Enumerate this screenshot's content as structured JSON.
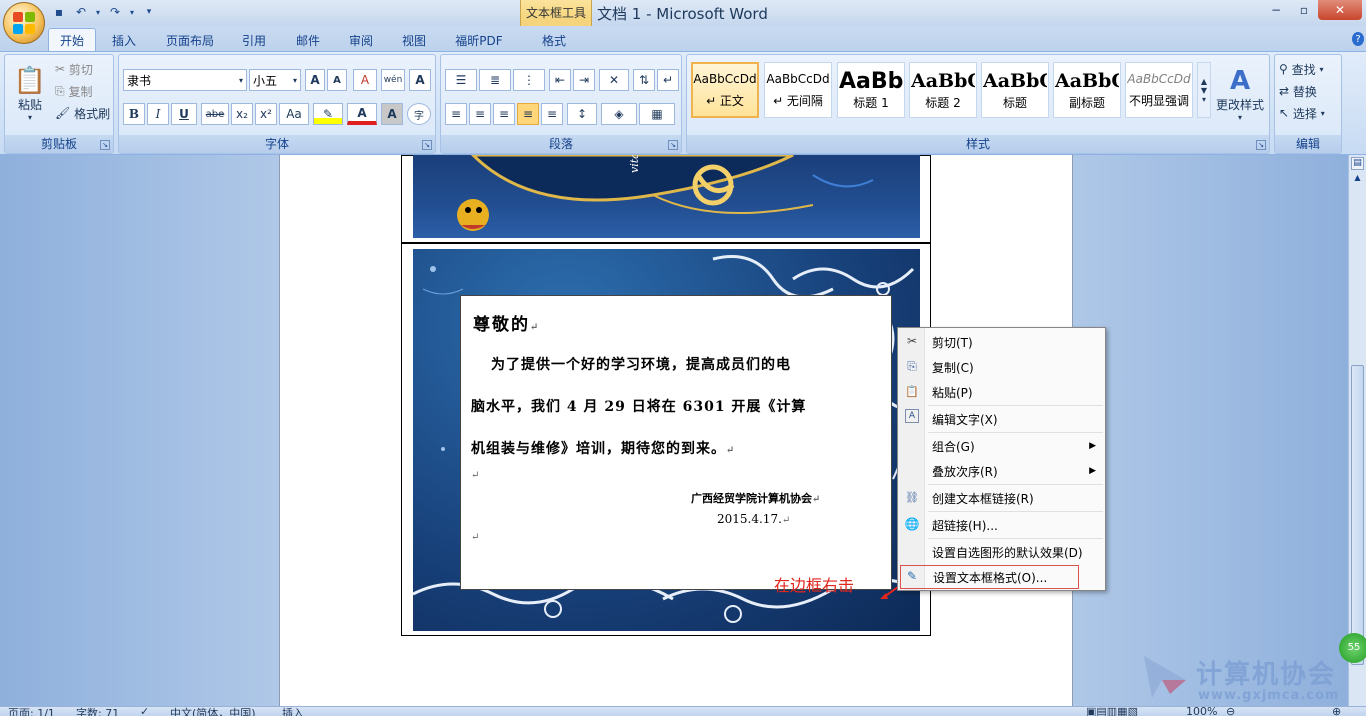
{
  "window": {
    "contextual_tab_group": "文本框工具",
    "title": "文档 1 - Microsoft Word",
    "min": "−",
    "max": "▫",
    "close": "✕"
  },
  "tabs": [
    "开始",
    "插入",
    "页面布局",
    "引用",
    "邮件",
    "审阅",
    "视图",
    "福昕PDF",
    "格式"
  ],
  "clipboard": {
    "paste": "粘贴",
    "cut": "剪切",
    "copy": "复制",
    "format_painter": "格式刷",
    "label": "剪贴板"
  },
  "font": {
    "name": "隶书",
    "size": "小五",
    "bold": "B",
    "italic": "I",
    "underline": "U",
    "strike": "abe",
    "subscript": "x₂",
    "superscript": "x²",
    "change_case": "Aa",
    "grow": "A",
    "shrink": "A",
    "clear": "A",
    "phonetic": "wén",
    "border": "A",
    "font_color": "A",
    "char_shade": "A",
    "enclose": "字",
    "label": "字体"
  },
  "paragraph": {
    "label": "段落"
  },
  "styles": {
    "label": "样式",
    "items": [
      {
        "sample": "AaBbCcDd",
        "name": "↵ 正文"
      },
      {
        "sample": "AaBbCcDd",
        "name": "↵ 无间隔"
      },
      {
        "sample": "AaBb",
        "name": "标题 1"
      },
      {
        "sample": "AaBbC",
        "name": "标题 2"
      },
      {
        "sample": "AaBbC",
        "name": "标题"
      },
      {
        "sample": "AaBbC",
        "name": "副标题"
      },
      {
        "sample": "AaBbCcDd",
        "name": "不明显强调"
      }
    ],
    "change_styles": "更改样式"
  },
  "editing": {
    "find": "查找",
    "replace": "替换",
    "select": "选择",
    "label": "编辑"
  },
  "textbox": {
    "salutation": "尊敬的",
    "line1": "为了提供一个好的学习环境，提高成员们的电",
    "line2": "脑水平，我们 4 月 29 日将在 6301 开展《计算",
    "line3": "机组装与维修》培训，期待您的到来。",
    "org": "广西经贸学院计算机协会",
    "date": "2015.4.17."
  },
  "image1_text": "vitation",
  "annotation": "在边框右击",
  "context_menu": [
    {
      "label": "剪切(T)",
      "icon": "scissors-icon",
      "glyph": "✂"
    },
    {
      "label": "复制(C)",
      "icon": "copy-icon",
      "glyph": "⎘"
    },
    {
      "label": "粘贴(P)",
      "icon": "paste-icon",
      "glyph": "📋"
    },
    {
      "label": "编辑文字(X)",
      "icon": "edit-text-icon",
      "glyph": "A"
    },
    {
      "label": "组合(G)",
      "icon": "",
      "glyph": ""
    },
    {
      "label": "叠放次序(R)",
      "icon": "",
      "glyph": ""
    },
    {
      "label": "创建文本框链接(R)",
      "icon": "link-icon",
      "glyph": "⛓"
    },
    {
      "label": "超链接(H)...",
      "icon": "hyperlink-icon",
      "glyph": "🌐"
    },
    {
      "label": "设置自选图形的默认效果(D)",
      "icon": "",
      "glyph": ""
    },
    {
      "label": "设置文本框格式(O)...",
      "icon": "format-textbox-icon",
      "glyph": "✎"
    }
  ],
  "status": {
    "page": "页面: 1/1",
    "words": "字数: 71",
    "lang": "中文(简体，中国)",
    "mode": "插入",
    "zoom": "100%"
  },
  "watermark": {
    "text": "计算机协会",
    "url": "www.gxjmca.com"
  },
  "colors": {
    "accent": "#15428b",
    "annotation": "#e0261d",
    "highlight_box": "#d9534f"
  }
}
